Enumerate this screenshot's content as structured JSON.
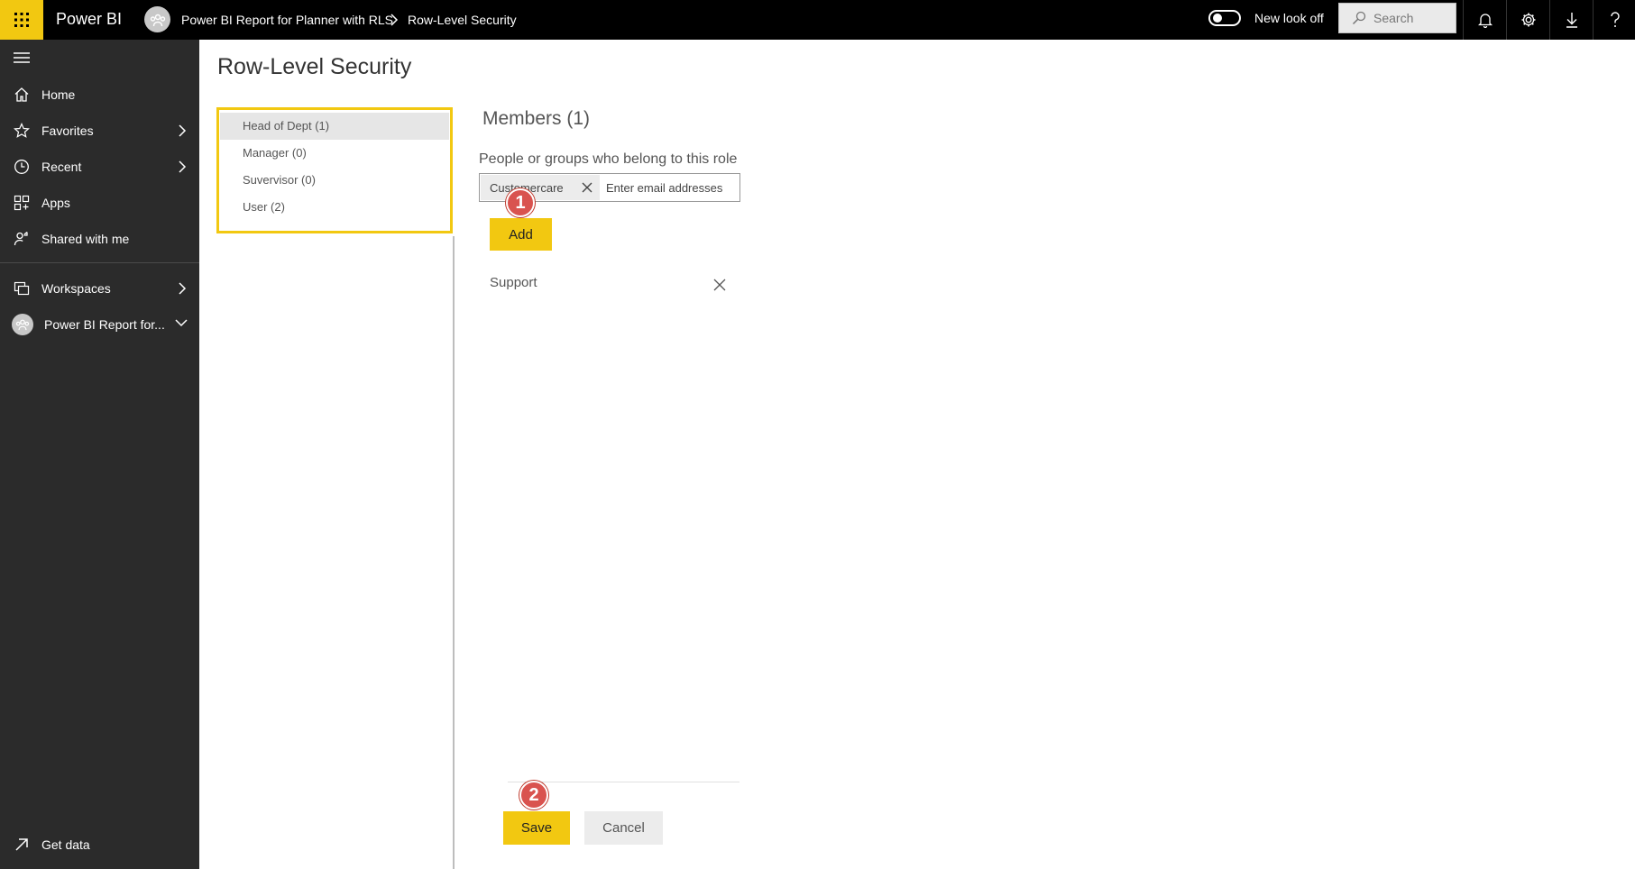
{
  "app": {
    "name": "Power BI"
  },
  "breadcrumb": {
    "workspace": "Power BI Report for Planner with RLS",
    "page": "Row-Level Security"
  },
  "topbar": {
    "toggle_label": "New look off",
    "search_placeholder": "Search",
    "icons": [
      "bell-icon",
      "gear-icon",
      "download-icon",
      "help-icon"
    ]
  },
  "sidebar": {
    "items": [
      {
        "label": "Home",
        "icon": "home-icon"
      },
      {
        "label": "Favorites",
        "icon": "star-icon"
      },
      {
        "label": "Recent",
        "icon": "clock-icon"
      },
      {
        "label": "Apps",
        "icon": "apps-icon"
      },
      {
        "label": "Shared with me",
        "icon": "shared-icon"
      },
      {
        "label": "Workspaces",
        "icon": "workspaces-icon"
      },
      {
        "label": "Power BI Report for...",
        "icon": "workspace-avatar-icon"
      }
    ],
    "get_data": "Get data"
  },
  "page": {
    "title": "Row-Level Security"
  },
  "roles": [
    {
      "label": "Head of Dept (1)",
      "selected": true
    },
    {
      "label": "Manager (0)",
      "selected": false
    },
    {
      "label": "Suvervisor (0)",
      "selected": false
    },
    {
      "label": "User (2)",
      "selected": false
    }
  ],
  "members": {
    "title": "Members (1)",
    "help_text": "People or groups who belong to this role",
    "chip": "Customercare",
    "email_placeholder": "Enter email addresses",
    "add_label": "Add",
    "list": [
      "Support"
    ]
  },
  "actions": {
    "save": "Save",
    "cancel": "Cancel"
  },
  "callouts": [
    "1",
    "2"
  ],
  "colors": {
    "accent": "#f2c811",
    "topbar": "#000000",
    "sidebar": "#2b2b2b",
    "callout": "#d9534f"
  }
}
